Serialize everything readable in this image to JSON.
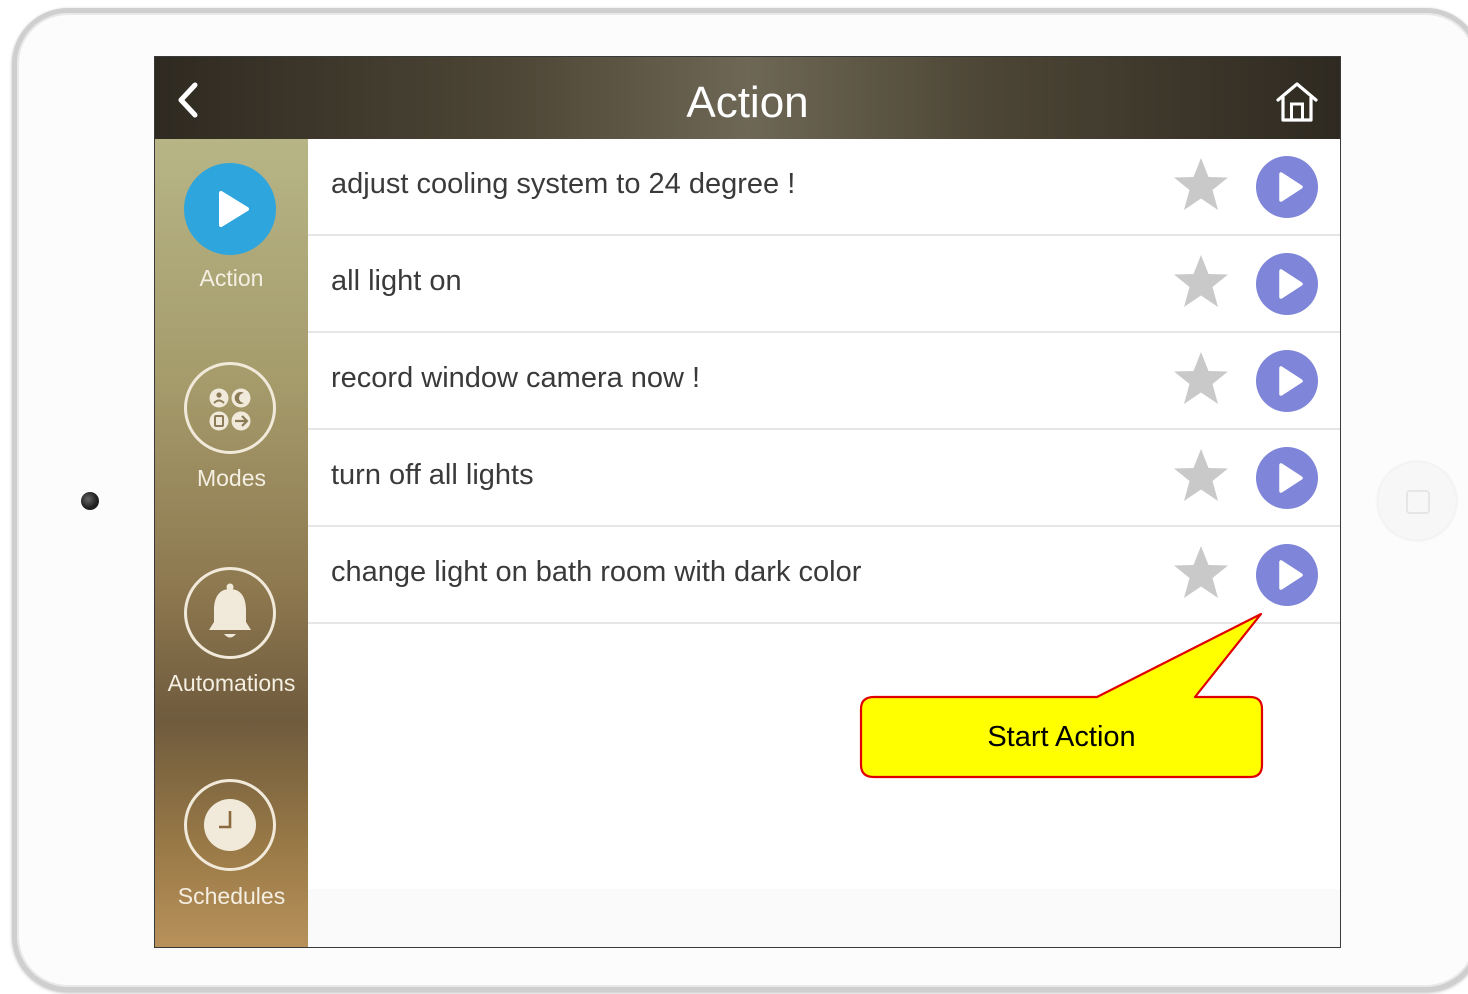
{
  "header": {
    "title": "Action"
  },
  "sidebar": {
    "items": [
      {
        "label": "Action",
        "icon": "play-icon",
        "active": true
      },
      {
        "label": "Modes",
        "icon": "modes-icon",
        "active": false
      },
      {
        "label": "Automations",
        "icon": "bell-icon",
        "active": false
      },
      {
        "label": "Schedules",
        "icon": "clock-icon",
        "active": false
      }
    ]
  },
  "actions": [
    {
      "label": "adjust cooling system to 24 degree !"
    },
    {
      "label": "all light on"
    },
    {
      "label": "record window camera now !"
    },
    {
      "label": "turn off all lights"
    },
    {
      "label": "change light on bath room with dark color"
    }
  ],
  "annotation": {
    "text": "Start Action"
  },
  "colors": {
    "accent_blue": "#2ea5dc",
    "play_purple": "#7f85d8",
    "star_gray": "#c9c9c9",
    "callout_fill": "#ffff00",
    "callout_border": "#e00000"
  }
}
